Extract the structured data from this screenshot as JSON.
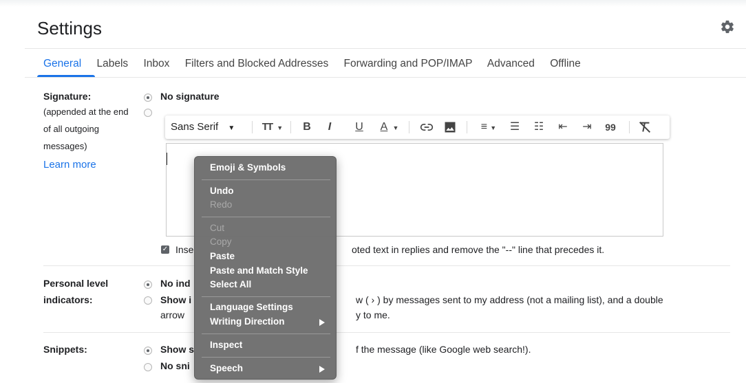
{
  "page": {
    "title": "Settings"
  },
  "tabs": [
    {
      "label": "General",
      "active": true
    },
    {
      "label": "Labels"
    },
    {
      "label": "Inbox"
    },
    {
      "label": "Filters and Blocked Addresses"
    },
    {
      "label": "Forwarding and POP/IMAP"
    },
    {
      "label": "Advanced"
    },
    {
      "label": "Offline"
    }
  ],
  "signature": {
    "label": "Signature:",
    "desc": [
      "(appended at the end",
      "of all outgoing",
      "messages)"
    ],
    "learn_more": "Learn more",
    "option_none": "No signature",
    "toolbar": {
      "font": "Sans Serif",
      "size_icon": "TT",
      "bold": "B",
      "italic": "I",
      "underline": "U",
      "text_color": "A",
      "quote": "99"
    },
    "checkbox_left": "Inse",
    "checkbox_right": "oted text in replies and remove the \"--\" line that precedes it."
  },
  "personal": {
    "label": [
      "Personal level",
      "indicators:"
    ],
    "option1": "No ind",
    "option2_bold": "Show i",
    "option2_rest": "w ( › ) by messages sent to my address (not a mailing list), and a double",
    "option2_line2_left": "arrow",
    "option2_line2_right": "y to me."
  },
  "snippets": {
    "label": "Snippets:",
    "option1_bold": "Show s",
    "option1_rest": "f the message (like Google web search!).",
    "option2_bold": "No sni"
  },
  "context_menu": {
    "emoji": "Emoji & Symbols",
    "undo": "Undo",
    "redo": "Redo",
    "cut": "Cut",
    "copy": "Copy",
    "paste": "Paste",
    "paste_match": "Paste and Match Style",
    "select_all": "Select All",
    "language": "Language Settings",
    "writing": "Writing Direction",
    "inspect": "Inspect",
    "speech": "Speech"
  },
  "colors": {
    "accent": "#1a73e8",
    "menu_bg": "#6e6e6e"
  }
}
